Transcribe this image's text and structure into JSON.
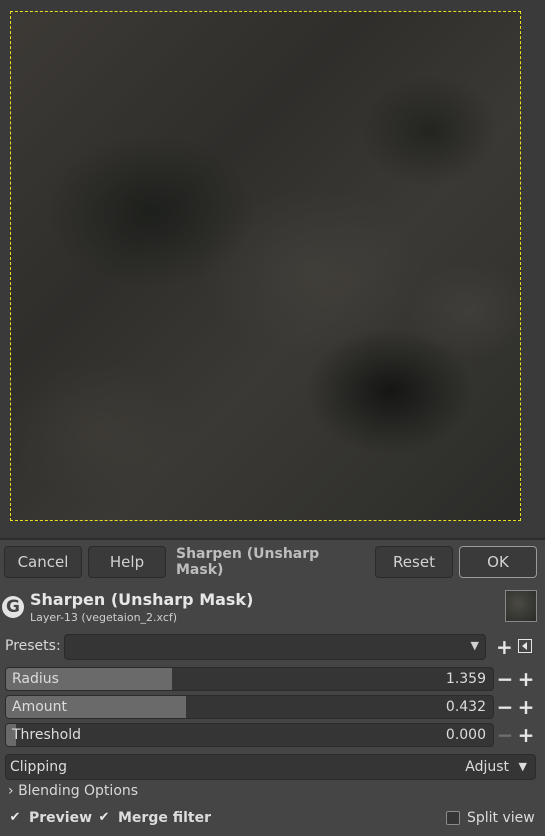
{
  "toolbar": {
    "cancel": "Cancel",
    "help": "Help",
    "title": "Sharpen (Unsharp Mask)",
    "reset": "Reset",
    "ok": "OK"
  },
  "header": {
    "icon_letter": "G",
    "title": "Sharpen (Unsharp Mask)",
    "subtitle": "Layer-13 (vegetaion_2.xcf)"
  },
  "presets": {
    "label": "Presets:",
    "value": "",
    "add_icon": "plus-icon",
    "menu_icon": "menu-icon"
  },
  "sliders": [
    {
      "label": "Radius",
      "value": "1.359",
      "fill": 0.34
    },
    {
      "label": "Amount",
      "value": "0.432",
      "fill": 0.37
    },
    {
      "label": "Threshold",
      "value": "0.000",
      "fill": 0.02
    }
  ],
  "clipping": {
    "label": "Clipping",
    "value": "Adjust"
  },
  "blending": {
    "label": "Blending Options"
  },
  "options": {
    "preview": "Preview",
    "merge": "Merge filter",
    "split": "Split view"
  },
  "colors": {
    "selection_border": "#e8e020",
    "background": "#454545"
  }
}
